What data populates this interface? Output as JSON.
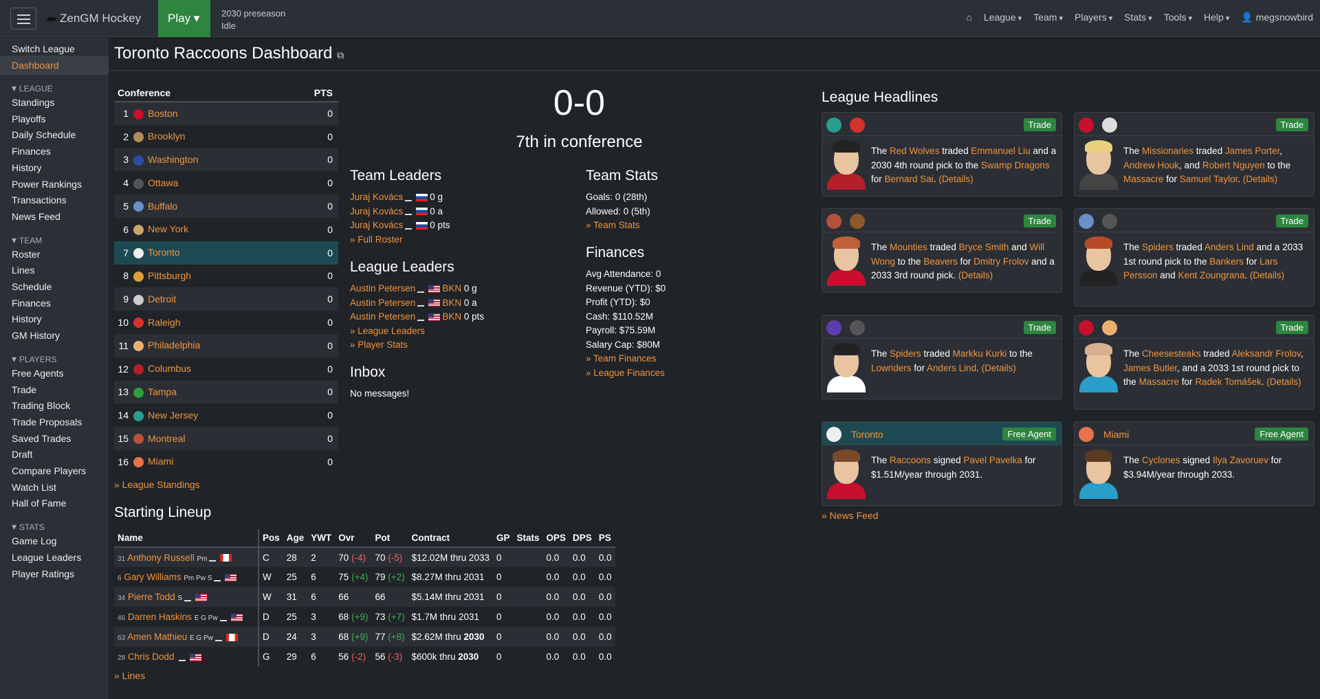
{
  "brand": "ZenGM Hockey",
  "play_label": "Play",
  "season": "2030 preseason",
  "status": "Idle",
  "topnav": [
    "League",
    "Team",
    "Players",
    "Stats",
    "Tools",
    "Help"
  ],
  "user": "megsnowbird",
  "sidebar": {
    "top": [
      "Switch League",
      "Dashboard"
    ],
    "league_head": "LEAGUE",
    "league": [
      "Standings",
      "Playoffs",
      "Daily Schedule",
      "Finances",
      "History",
      "Power Rankings",
      "Transactions",
      "News Feed"
    ],
    "team_head": "TEAM",
    "team": [
      "Roster",
      "Lines",
      "Schedule",
      "Finances",
      "History",
      "GM History"
    ],
    "players_head": "PLAYERS",
    "players": [
      "Free Agents",
      "Trade",
      "Trading Block",
      "Trade Proposals",
      "Saved Trades",
      "Draft",
      "Compare Players",
      "Watch List",
      "Hall of Fame"
    ],
    "stats_head": "STATS",
    "stats": [
      "Game Log",
      "League Leaders",
      "Player Ratings"
    ]
  },
  "page_title": "Toronto Raccoons Dashboard",
  "conference": {
    "header": "Conference",
    "pts_header": "PTS",
    "rows": [
      {
        "rank": "1",
        "team": "Boston",
        "pts": "0",
        "color": "#c8102e"
      },
      {
        "rank": "2",
        "team": "Brooklyn",
        "pts": "0",
        "color": "#b08d57"
      },
      {
        "rank": "3",
        "team": "Washington",
        "pts": "0",
        "color": "#2a4ea0"
      },
      {
        "rank": "4",
        "team": "Ottawa",
        "pts": "0",
        "color": "#555555"
      },
      {
        "rank": "5",
        "team": "Buffalo",
        "pts": "0",
        "color": "#6a8fc9"
      },
      {
        "rank": "6",
        "team": "New York",
        "pts": "0",
        "color": "#c9a46b"
      },
      {
        "rank": "7",
        "team": "Toronto",
        "pts": "0",
        "color": "#eeeeee"
      },
      {
        "rank": "8",
        "team": "Pittsburgh",
        "pts": "0",
        "color": "#d9a03b"
      },
      {
        "rank": "9",
        "team": "Detroit",
        "pts": "0",
        "color": "#cccccc"
      },
      {
        "rank": "10",
        "team": "Raleigh",
        "pts": "0",
        "color": "#d4322b"
      },
      {
        "rank": "11",
        "team": "Philadelphia",
        "pts": "0",
        "color": "#e9b070"
      },
      {
        "rank": "12",
        "team": "Columbus",
        "pts": "0",
        "color": "#b3202a"
      },
      {
        "rank": "13",
        "team": "Tampa",
        "pts": "0",
        "color": "#2e9c3c"
      },
      {
        "rank": "14",
        "team": "New Jersey",
        "pts": "0",
        "color": "#2a9d8f"
      },
      {
        "rank": "15",
        "team": "Montreal",
        "pts": "0",
        "color": "#b5523b"
      },
      {
        "rank": "16",
        "team": "Miami",
        "pts": "0",
        "color": "#e8734a"
      }
    ],
    "standings_link": "» League Standings"
  },
  "record": "0-0",
  "conf_rank": "7th in conference",
  "team_leaders": {
    "title": "Team Leaders",
    "rows": [
      {
        "name": "Juraj Kovács",
        "stat": "0 g"
      },
      {
        "name": "Juraj Kovács",
        "stat": "0 a"
      },
      {
        "name": "Juraj Kovács",
        "stat": "0 pts"
      }
    ],
    "link": "» Full Roster"
  },
  "league_leaders": {
    "title": "League Leaders",
    "rows": [
      {
        "name": "Austin Petersen",
        "team": "BKN",
        "stat": "0 g"
      },
      {
        "name": "Austin Petersen",
        "team": "BKN",
        "stat": "0 a"
      },
      {
        "name": "Austin Petersen",
        "team": "BKN",
        "stat": "0 pts"
      }
    ],
    "link1": "» League Leaders",
    "link2": "» Player Stats"
  },
  "inbox": {
    "title": "Inbox",
    "message": "No messages!"
  },
  "team_stats": {
    "title": "Team Stats",
    "goals": "Goals: 0 (28th)",
    "allowed": "Allowed: 0 (5th)",
    "link": "» Team Stats"
  },
  "finances": {
    "title": "Finances",
    "lines": [
      "Avg Attendance: 0",
      "Revenue (YTD): $0",
      "Profit (YTD): $0",
      "Cash: $110.52M",
      "Payroll: $75.59M",
      "Salary Cap: $80M"
    ],
    "link1": "» Team Finances",
    "link2": "» League Finances"
  },
  "headlines": {
    "title": "League Headlines",
    "trade_badge": "Trade",
    "fa_badge": "Free Agent",
    "cards": [
      {
        "parts": [
          [
            "t",
            "The "
          ],
          [
            "a",
            "Red Wolves"
          ],
          [
            "t",
            " traded "
          ],
          [
            "a",
            "Emmanuel Liu"
          ],
          [
            "t",
            " and a 2030 4th round pick to the "
          ],
          [
            "a",
            "Swamp Dragons"
          ],
          [
            "t",
            " for "
          ],
          [
            "a",
            "Bernard Sai"
          ],
          [
            "t",
            ". "
          ],
          [
            "a",
            "(Details)"
          ]
        ],
        "logo1": "#2a9d8f",
        "logo2": "#d4322b",
        "hair": "#222222",
        "jersey": "#b3202a"
      },
      {
        "parts": [
          [
            "t",
            "The "
          ],
          [
            "a",
            "Missionaries"
          ],
          [
            "t",
            " traded "
          ],
          [
            "a",
            "James Porter"
          ],
          [
            "t",
            ", "
          ],
          [
            "a",
            "Andrew Houk"
          ],
          [
            "t",
            ", and "
          ],
          [
            "a",
            "Robert Nguyen"
          ],
          [
            "t",
            " to the "
          ],
          [
            "a",
            "Massacre"
          ],
          [
            "t",
            " for "
          ],
          [
            "a",
            "Samuel Taylor"
          ],
          [
            "t",
            ". "
          ],
          [
            "a",
            "(Details)"
          ]
        ],
        "logo1": "#c8102e",
        "logo2": "#dddddd",
        "hair": "#e8d080",
        "jersey": "#444444"
      },
      {
        "parts": [
          [
            "t",
            "The "
          ],
          [
            "a",
            "Mounties"
          ],
          [
            "t",
            " traded "
          ],
          [
            "a",
            "Bryce Smith"
          ],
          [
            "t",
            " and "
          ],
          [
            "a",
            "Will Wong"
          ],
          [
            "t",
            " to the "
          ],
          [
            "a",
            "Beavers"
          ],
          [
            "t",
            " for "
          ],
          [
            "a",
            "Dmitry Frolov"
          ],
          [
            "t",
            " and a 2033 3rd round pick. "
          ],
          [
            "a",
            "(Details)"
          ]
        ],
        "logo1": "#b5523b",
        "logo2": "#8a5a2b",
        "hair": "#c0603a",
        "jersey": "#c8102e"
      },
      {
        "parts": [
          [
            "t",
            "The "
          ],
          [
            "a",
            "Spiders"
          ],
          [
            "t",
            " traded "
          ],
          [
            "a",
            "Anders Lind"
          ],
          [
            "t",
            " and a 2033 1st round pick to the "
          ],
          [
            "a",
            "Bankers"
          ],
          [
            "t",
            " for "
          ],
          [
            "a",
            "Lars Persson"
          ],
          [
            "t",
            " and "
          ],
          [
            "a",
            "Kent Zoungrana"
          ],
          [
            "t",
            ". "
          ],
          [
            "a",
            "(Details)"
          ]
        ],
        "logo1": "#6a8fc9",
        "logo2": "#555555",
        "hair": "#b84a2a",
        "jersey": "#222222"
      },
      {
        "parts": [
          [
            "t",
            "The "
          ],
          [
            "a",
            "Spiders"
          ],
          [
            "t",
            " traded "
          ],
          [
            "a",
            "Markku Kurki"
          ],
          [
            "t",
            " to the "
          ],
          [
            "a",
            "Lowriders"
          ],
          [
            "t",
            " for "
          ],
          [
            "a",
            "Anders Lind"
          ],
          [
            "t",
            ". "
          ],
          [
            "a",
            "(Details)"
          ]
        ],
        "logo1": "#5b3fb0",
        "logo2": "#555555",
        "hair": "#222222",
        "jersey": "#ffffff"
      },
      {
        "parts": [
          [
            "t",
            "The "
          ],
          [
            "a",
            "Cheesesteaks"
          ],
          [
            "t",
            " traded "
          ],
          [
            "a",
            "Aleksandr Frolov"
          ],
          [
            "t",
            ", "
          ],
          [
            "a",
            "James Butler"
          ],
          [
            "t",
            ", and a 2033 1st round pick to the "
          ],
          [
            "a",
            "Massacre"
          ],
          [
            "t",
            " for "
          ],
          [
            "a",
            "Radek Tomášek"
          ],
          [
            "t",
            ". "
          ],
          [
            "a",
            "(Details)"
          ]
        ],
        "logo1": "#c8102e",
        "logo2": "#e9b070",
        "hair": "#d8b090",
        "jersey": "#2a9dc9"
      },
      {
        "team": "Toronto",
        "parts": [
          [
            "t",
            "The "
          ],
          [
            "a",
            "Raccoons"
          ],
          [
            "t",
            " signed "
          ],
          [
            "a",
            "Pavel Pavelka"
          ],
          [
            "t",
            " for $1.51M/year through 2031."
          ]
        ],
        "logo1": "#eeeeee",
        "hair": "#7a4a2a",
        "jersey": "#c8102e"
      },
      {
        "team": "Miami",
        "parts": [
          [
            "t",
            "The "
          ],
          [
            "a",
            "Cyclones"
          ],
          [
            "t",
            " signed "
          ],
          [
            "a",
            "Ilya Zavoruev"
          ],
          [
            "t",
            " for $3.94M/year through 2033."
          ]
        ],
        "logo1": "#e8734a",
        "hair": "#5a3a20",
        "jersey": "#2a9dc9"
      }
    ],
    "news_feed_link": "» News Feed"
  },
  "lineup": {
    "title": "Starting Lineup",
    "headers": [
      "Name",
      "Pos",
      "Age",
      "YWT",
      "Ovr",
      "Pot",
      "Contract",
      "GP",
      "Stats",
      "OPS",
      "DPS",
      "PS"
    ],
    "rows": [
      {
        "num": "31",
        "name": "Anthony Russell",
        "skills": "Pm",
        "flag": "ca",
        "pos": "C",
        "age": "28",
        "ywt": "2",
        "ovr": "70",
        "ovr_d": "(-4)",
        "ovr_c": "neg",
        "pot": "70",
        "pot_d": "(-5)",
        "pot_c": "neg",
        "contract": "$12.02M thru 2033",
        "bold": false,
        "gp": "0",
        "ops": "0.0",
        "dps": "0.0",
        "ps": "0.0"
      },
      {
        "num": "6",
        "name": "Gary Williams",
        "skills": "Pm Pw S",
        "flag": "us",
        "pos": "W",
        "age": "25",
        "ywt": "6",
        "ovr": "75",
        "ovr_d": "(+4)",
        "ovr_c": "pos",
        "pot": "79",
        "pot_d": "(+2)",
        "pot_c": "pos",
        "contract": "$8.27M thru 2031",
        "bold": false,
        "gp": "0",
        "ops": "0.0",
        "dps": "0.0",
        "ps": "0.0"
      },
      {
        "num": "34",
        "name": "Pierre Todd",
        "skills": "S",
        "flag": "us",
        "pos": "W",
        "age": "31",
        "ywt": "6",
        "ovr": "66",
        "ovr_d": "",
        "ovr_c": "",
        "pot": "66",
        "pot_d": "",
        "pot_c": "",
        "contract": "$5.14M thru 2031",
        "bold": false,
        "gp": "0",
        "ops": "0.0",
        "dps": "0.0",
        "ps": "0.0"
      },
      {
        "num": "46",
        "name": "Darren Haskins",
        "skills": "E G Pw",
        "flag": "us",
        "pos": "D",
        "age": "25",
        "ywt": "3",
        "ovr": "68",
        "ovr_d": "(+9)",
        "ovr_c": "pos",
        "pot": "73",
        "pot_d": "(+7)",
        "pot_c": "pos",
        "contract": "$1.7M thru 2031",
        "bold": false,
        "gp": "0",
        "ops": "0.0",
        "dps": "0.0",
        "ps": "0.0"
      },
      {
        "num": "63",
        "name": "Amen Mathieu",
        "skills": "E G Pw",
        "flag": "ca",
        "pos": "D",
        "age": "24",
        "ywt": "3",
        "ovr": "68",
        "ovr_d": "(+9)",
        "ovr_c": "pos",
        "pot": "77",
        "pot_d": "(+8)",
        "pot_c": "pos",
        "contract": "$2.62M thru ",
        "contract_b": "2030",
        "gp": "0",
        "ops": "0.0",
        "dps": "0.0",
        "ps": "0.0"
      },
      {
        "num": "28",
        "name": "Chris Dodd",
        "skills": "",
        "flag": "us",
        "pos": "G",
        "age": "29",
        "ywt": "6",
        "ovr": "56",
        "ovr_d": "(-2)",
        "ovr_c": "neg",
        "pot": "56",
        "pot_d": "(-3)",
        "pot_c": "neg",
        "contract": "$600k thru ",
        "contract_b": "2030",
        "gp": "0",
        "ops": "0.0",
        "dps": "0.0",
        "ps": "0.0"
      }
    ],
    "lines_link": "» Lines"
  }
}
